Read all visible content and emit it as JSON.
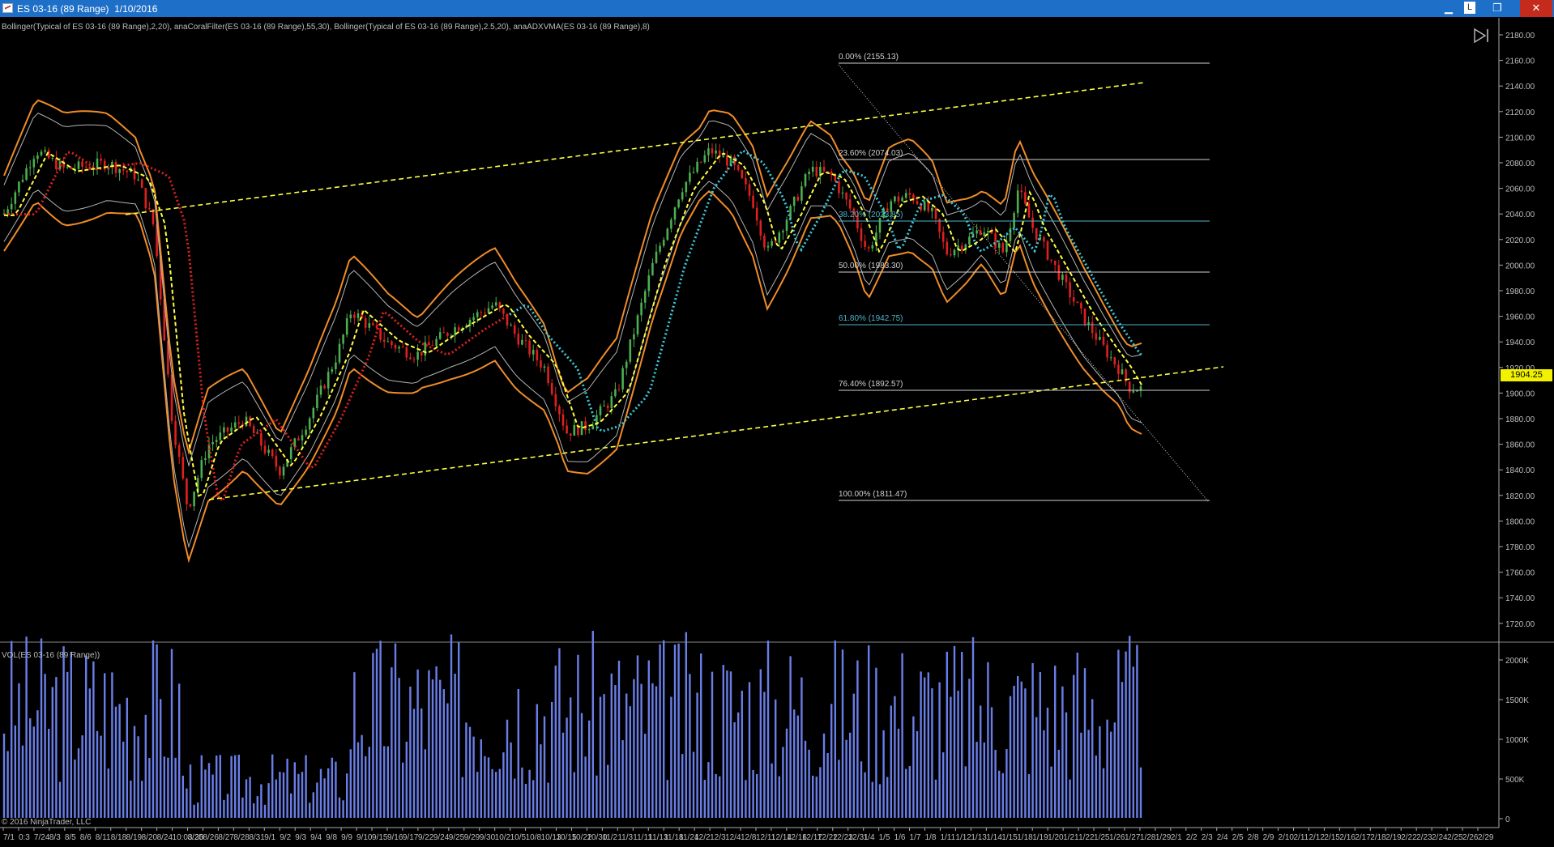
{
  "window": {
    "title": "ES 03-16 (89 Range)  1/10/2016",
    "link_label": "L",
    "minimize_label": "▁",
    "restore_label": "❐",
    "close_label": "✕"
  },
  "price_panel": {
    "indicator_text": "Bollinger(Typical of ES 03-16 (89 Range),2,20), anaCoralFilter(ES 03-16 (89 Range),55,30), Bollinger(Typical of ES 03-16 (89 Range),2.5,20), anaADXVMA(ES 03-16 (89 Range),8)",
    "y_ticks": [
      "2180.00",
      "2160.00",
      "2140.00",
      "2120.00",
      "2100.00",
      "2080.00",
      "2060.00",
      "2040.00",
      "2020.00",
      "2000.00",
      "1980.00",
      "1960.00",
      "1940.00",
      "1920.00",
      "1900.00",
      "1880.00",
      "1860.00",
      "1840.00",
      "1820.00",
      "1800.00",
      "1780.00",
      "1760.00",
      "1740.00",
      "1720.00"
    ],
    "last_price": "1904.25",
    "fib_levels": [
      {
        "label": "0.00% (2155.13)",
        "color": "#cfcfcf"
      },
      {
        "label": "23.60% (2074.03)",
        "color": "#cfcfcf"
      },
      {
        "label": "38.20% (2023.85)",
        "color": "#4fb3c7"
      },
      {
        "label": "50.00% (1983.30)",
        "color": "#cfcfcf"
      },
      {
        "label": "61.80% (1942.75)",
        "color": "#4fb3c7"
      },
      {
        "label": "76.40% (1892.57)",
        "color": "#cfcfcf"
      },
      {
        "label": "100.00% (1811.47)",
        "color": "#cfcfcf"
      }
    ]
  },
  "volume_panel": {
    "label": "VOL(ES 03-16 (89 Range))",
    "y_ticks": [
      "2000K",
      "1500K",
      "1000K",
      "500K",
      "0"
    ]
  },
  "x_axis": {
    "labels": [
      "7/1",
      "0:3",
      "7/24",
      "8/3",
      "8/5",
      "8/6",
      "8/11",
      "8/18",
      "8/19",
      "8/20",
      "8/24",
      "10:03:30",
      "8/25",
      "8/26",
      "8/27",
      "8/28",
      "8/31",
      "9/1",
      "9/2",
      "9/3",
      "9/4",
      "9/8",
      "9/9",
      "9/10",
      "9/15",
      "9/16",
      "9/17",
      "9/22",
      "9/24",
      "9/25",
      "9/29",
      "9/30",
      "10/2",
      "10/5",
      "10/8",
      "10/13",
      "10/15",
      "10/22",
      "10/30",
      "11/2",
      "11/3",
      "11/11",
      "11/13",
      "11/18",
      "11/24",
      "12/2",
      "12/3",
      "12/4",
      "12/8",
      "12/11",
      "12/14",
      "12/16",
      "12/17",
      "12/22",
      "12/23",
      "12/31",
      "1/4",
      "1/5",
      "1/6",
      "1/7",
      "1/8",
      "1/11",
      "1/12",
      "1/13",
      "1/14",
      "1/15",
      "1/18",
      "1/19",
      "1/20",
      "1/21",
      "1/22",
      "1/25",
      "1/26",
      "1/27",
      "1/28",
      "1/29",
      "2/1",
      "2/2",
      "2/3",
      "2/4",
      "2/5",
      "2/8",
      "2/9",
      "2/10",
      "2/11",
      "2/12",
      "2/15",
      "2/16",
      "2/17",
      "2/18",
      "2/19",
      "2/22",
      "2/23",
      "2/24",
      "2/25",
      "2/26",
      "2/29"
    ]
  },
  "copyright": "© 2016 NinjaTrader, LLC",
  "colors": {
    "titlebar": "#1e6fc8",
    "up_bar": "#4caf50",
    "down_bar": "#e02020",
    "band_outer": "#f08c28",
    "band_inner": "#b4b4b4",
    "coral_up": "#3ec8d8",
    "coral_down": "#e02020",
    "adxvma": "#ffff40",
    "channel": "#ffff40",
    "volume": "#6a7ee8",
    "price_tag": "#f2f200"
  }
}
